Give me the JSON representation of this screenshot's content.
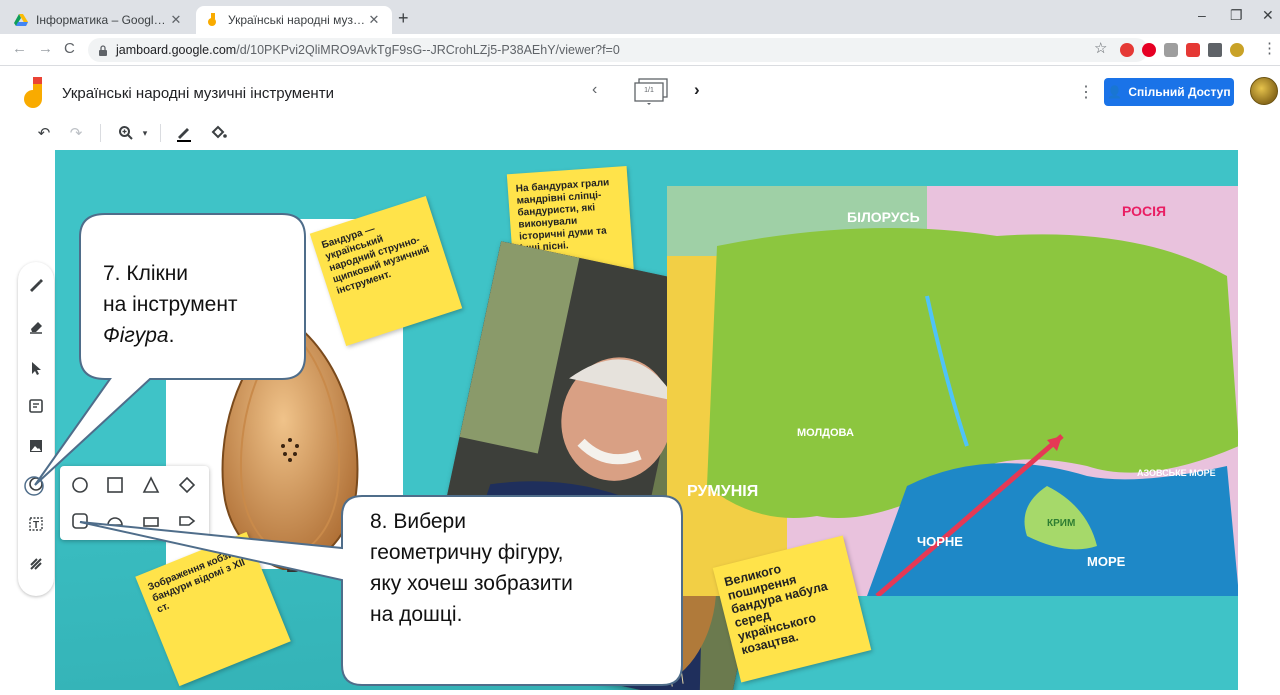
{
  "browser": {
    "tabs": [
      {
        "title": "Інформатика – Google Диск",
        "active": false
      },
      {
        "title": "Українські народні музичні інст",
        "active": true
      }
    ],
    "new_tab_icon": "plus-icon",
    "url_host": "jamboard.google.com",
    "url_path": "/d/10PKPvi2QliMRO9AvkTgF9sG--JRCrohLZj5-P38AEhY/viewer?f=0"
  },
  "header": {
    "title": "Українські народні музичні інструменти",
    "frame_counter": "1/1",
    "share_label": "Спільний Доступ",
    "colors": {
      "share_button": "#1a73e8",
      "canvas_bg": "#3fc3c7",
      "sticky": "#ffe34a"
    }
  },
  "board": {
    "sticky_notes": [
      "Бандура — український народний струнно-щипковий музичний інструмент.",
      "На бандурах грали мандрівні сліпці-бандуристи, які виконували історичні думи та інші пісні.",
      "Зображення кобзи-бандури відомі з XII ст.",
      "Великого поширення бандура набула серед українського козацтва."
    ],
    "caption_fragment": "Бан",
    "map_labels": [
      "БІЛОРУСЬ",
      "РОСІЯ",
      "МОЛДОВА",
      "РУМУНІЯ",
      "АЗОВСЬКЕ МОРЕ",
      "ЧОРНЕ",
      "МОРЕ",
      "КРИМ"
    ]
  },
  "side_tools": [
    "pen-icon",
    "eraser-icon",
    "select-icon",
    "sticky-note-icon",
    "image-icon",
    "shape-icon",
    "text-box-icon",
    "laser-icon"
  ],
  "shape_menu": [
    "circle",
    "square",
    "triangle",
    "diamond",
    "rounded-square",
    "semicircle",
    "bar",
    "arrow"
  ],
  "callouts": [
    {
      "line1": "7. Клікни",
      "line2": "на інструмент",
      "line3_italic": "Фігура",
      "line3_tail": "."
    },
    {
      "line1": "8. Вибери",
      "line2": "геометричну фігуру,",
      "line3": "яку хочеш зобразити",
      "line4": "на дошці."
    }
  ]
}
